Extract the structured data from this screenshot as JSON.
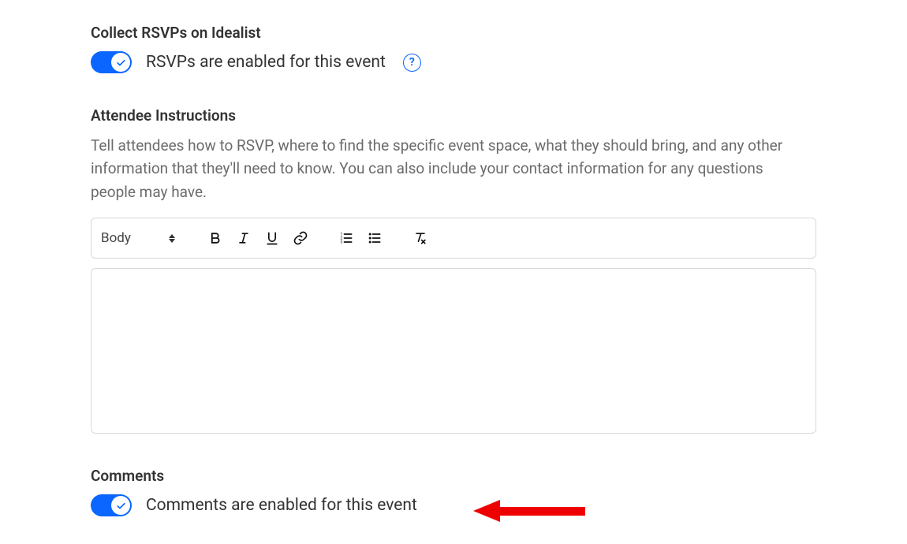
{
  "rsvp": {
    "title": "Collect RSVPs on Idealist",
    "toggle_label": "RSVPs are enabled for this event",
    "help_char": "?"
  },
  "instructions": {
    "title": "Attendee Instructions",
    "description": "Tell attendees how to RSVP, where to find the specific event space, what they should bring, and any other information that they'll need to know. You can also include your contact information for any questions people may have."
  },
  "editor": {
    "format_selected": "Body",
    "content": ""
  },
  "comments": {
    "title": "Comments",
    "toggle_label": "Comments are enabled for this event"
  },
  "colors": {
    "accent": "#0a66ff",
    "annotation": "#ef0000"
  }
}
